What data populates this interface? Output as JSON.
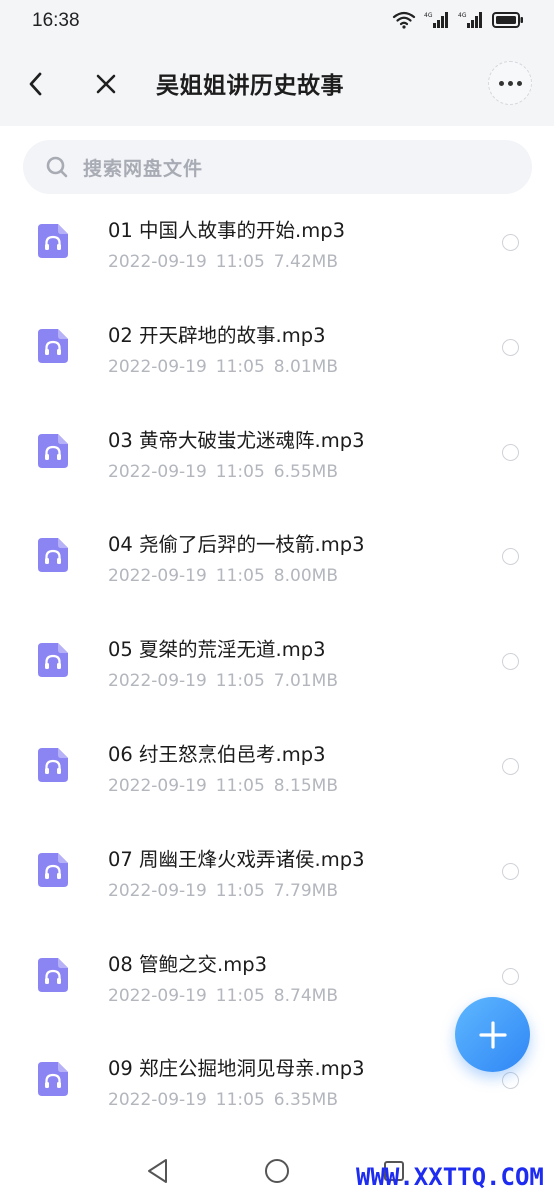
{
  "status_bar": {
    "time": "16:38",
    "icons": [
      "wifi-icon",
      "signal-4g-icon",
      "signal-4g-icon",
      "battery-icon"
    ],
    "network_label": "4G"
  },
  "header": {
    "title": "吴姐姐讲历史故事",
    "back_icon": "chevron-left-icon",
    "close_icon": "close-icon",
    "more_icon": "more-icon"
  },
  "search": {
    "placeholder": "搜索网盘文件",
    "icon": "search-icon"
  },
  "files": [
    {
      "name": "01 中国人故事的开始.mp3",
      "date": "2022-09-19",
      "time": "11:05",
      "size": "7.42MB"
    },
    {
      "name": "02 开天辟地的故事.mp3",
      "date": "2022-09-19",
      "time": "11:05",
      "size": "8.01MB"
    },
    {
      "name": "03 黄帝大破蚩尤迷魂阵.mp3",
      "date": "2022-09-19",
      "time": "11:05",
      "size": "6.55MB"
    },
    {
      "name": "04 尧偷了后羿的一枝箭.mp3",
      "date": "2022-09-19",
      "time": "11:05",
      "size": "8.00MB"
    },
    {
      "name": "05 夏桀的荒淫无道.mp3",
      "date": "2022-09-19",
      "time": "11:05",
      "size": "7.01MB"
    },
    {
      "name": "06 纣王怒烹伯邑考.mp3",
      "date": "2022-09-19",
      "time": "11:05",
      "size": "8.15MB"
    },
    {
      "name": "07 周幽王烽火戏弄诸侯.mp3",
      "date": "2022-09-19",
      "time": "11:05",
      "size": "7.79MB"
    },
    {
      "name": "08 管鲍之交.mp3",
      "date": "2022-09-19",
      "time": "11:05",
      "size": "8.74MB"
    },
    {
      "name": "09 郑庄公掘地洞见母亲.mp3",
      "date": "2022-09-19",
      "time": "11:05",
      "size": "6.35MB"
    }
  ],
  "fab": {
    "icon": "plus-icon"
  },
  "navbar": {
    "icons": [
      "nav-back-icon",
      "nav-home-icon",
      "nav-recent-icon"
    ]
  },
  "watermark": "WWW.XXTTQ.COM",
  "colors": {
    "accent": "#2f86f5",
    "audio_icon": "#8b84f3",
    "meta_text": "#b3b6bd",
    "header_bg": "#f4f5f7",
    "watermark": "#1d2cf0"
  }
}
